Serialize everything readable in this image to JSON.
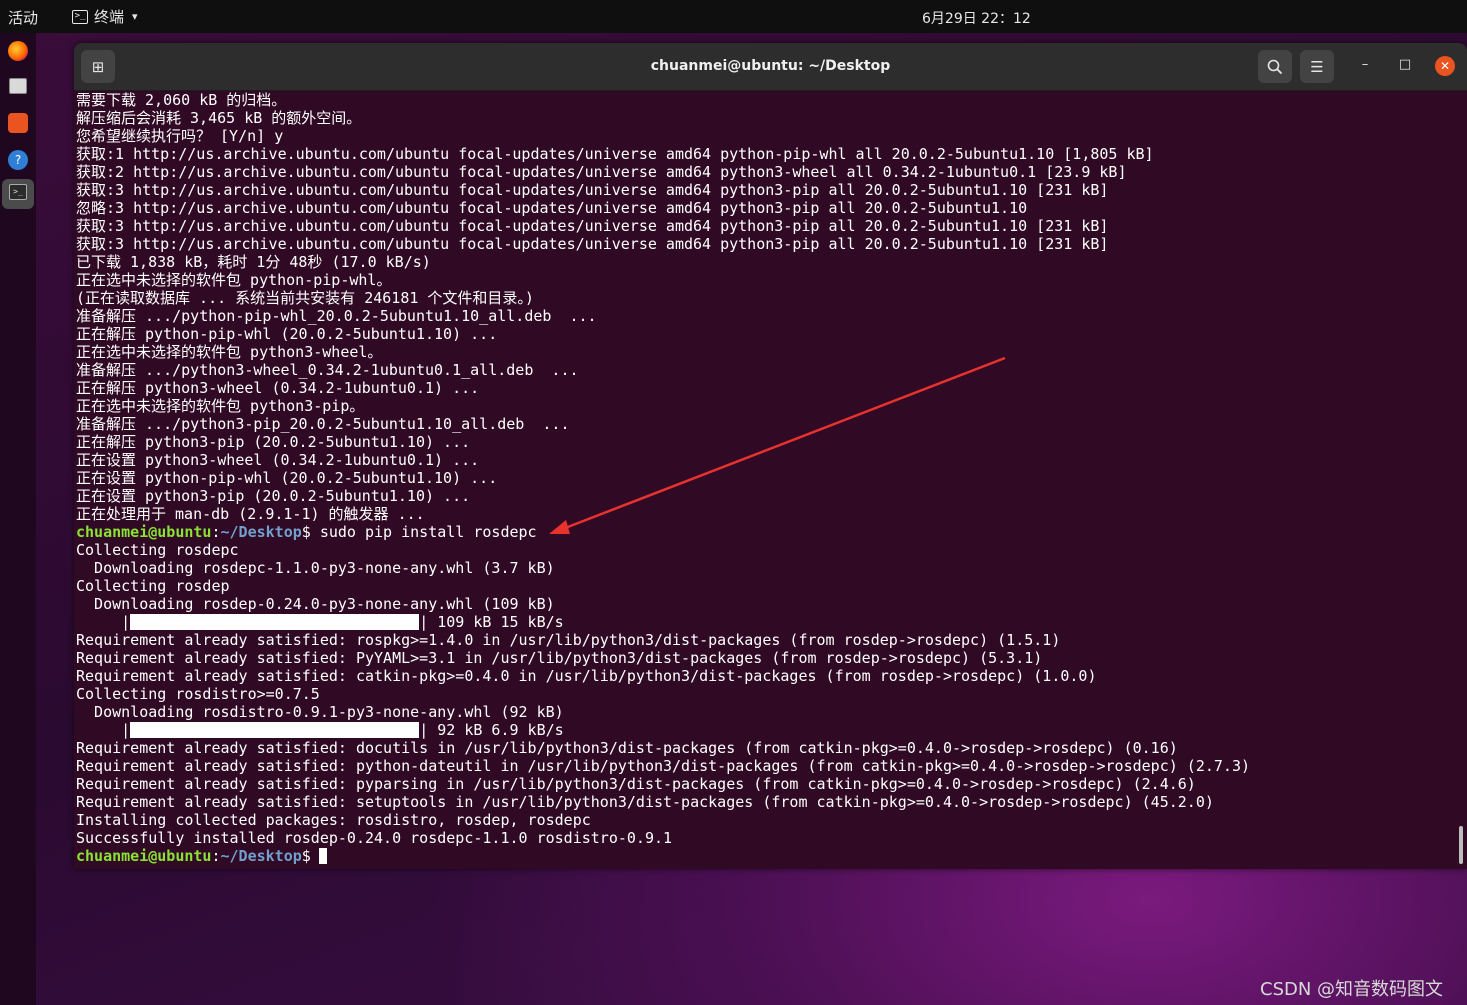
{
  "topbar": {
    "activities": "活动",
    "app_icon": "terminal-icon",
    "app_name": "终端",
    "caret": "▾",
    "clock": "6月29日  22：12"
  },
  "dock": {
    "apps": [
      "firefox-icon",
      "files-icon",
      "software-store-icon",
      "help-icon",
      "terminal-icon"
    ]
  },
  "window": {
    "title": "chuanmei@ubuntu: ~/Desktop",
    "new_tab_icon": "⊞",
    "search_icon": "⌕",
    "menu_icon": "☰",
    "minimize": "–",
    "maximize": "□",
    "close": "✕"
  },
  "prompt": {
    "user": "chuanmei@ubuntu",
    "colon": ":",
    "path": "~/Desktop",
    "dollar": "$"
  },
  "lines_before": [
    "需要下载 2,060 kB 的归档。",
    "解压缩后会消耗 3,465 kB 的额外空间。",
    "您希望继续执行吗？ [Y/n] y",
    "获取:1 http://us.archive.ubuntu.com/ubuntu focal-updates/universe amd64 python-pip-whl all 20.0.2-5ubuntu1.10 [1,805 kB]",
    "获取:2 http://us.archive.ubuntu.com/ubuntu focal-updates/universe amd64 python3-wheel all 0.34.2-1ubuntu0.1 [23.9 kB]",
    "获取:3 http://us.archive.ubuntu.com/ubuntu focal-updates/universe amd64 python3-pip all 20.0.2-5ubuntu1.10 [231 kB]",
    "忽略:3 http://us.archive.ubuntu.com/ubuntu focal-updates/universe amd64 python3-pip all 20.0.2-5ubuntu1.10",
    "获取:3 http://us.archive.ubuntu.com/ubuntu focal-updates/universe amd64 python3-pip all 20.0.2-5ubuntu1.10 [231 kB]",
    "获取:3 http://us.archive.ubuntu.com/ubuntu focal-updates/universe amd64 python3-pip all 20.0.2-5ubuntu1.10 [231 kB]",
    "已下载 1,838 kB，耗时 1分 48秒 (17.0 kB/s)",
    "正在选中未选择的软件包 python-pip-whl。",
    "(正在读取数据库 ... 系统当前共安装有 246181 个文件和目录。)",
    "准备解压 .../python-pip-whl_20.0.2-5ubuntu1.10_all.deb  ...",
    "正在解压 python-pip-whl (20.0.2-5ubuntu1.10) ...",
    "正在选中未选择的软件包 python3-wheel。",
    "准备解压 .../python3-wheel_0.34.2-1ubuntu0.1_all.deb  ...",
    "正在解压 python3-wheel (0.34.2-1ubuntu0.1) ...",
    "正在选中未选择的软件包 python3-pip。",
    "准备解压 .../python3-pip_20.0.2-5ubuntu1.10_all.deb  ...",
    "正在解压 python3-pip (20.0.2-5ubuntu1.10) ...",
    "正在设置 python3-wheel (0.34.2-1ubuntu0.1) ...",
    "正在设置 python-pip-whl (20.0.2-5ubuntu1.10) ...",
    "正在设置 python3-pip (20.0.2-5ubuntu1.10) ...",
    "正在处理用于 man-db (2.9.1-1) 的触发器 ..."
  ],
  "command": " sudo pip install rosdepc",
  "lines_mid1": [
    "Collecting rosdepc",
    "  Downloading rosdepc-1.1.0-py3-none-any.whl (3.7 kB)",
    "Collecting rosdep",
    "  Downloading rosdep-0.24.0-py3-none-any.whl (109 kB)"
  ],
  "progress1": {
    "prefix": "     |",
    "suffix": "| 109 kB 15 kB/s",
    "percent": 100
  },
  "lines_mid2": [
    "Requirement already satisfied: rospkg>=1.4.0 in /usr/lib/python3/dist-packages (from rosdep->rosdepc) (1.5.1)",
    "Requirement already satisfied: PyYAML>=3.1 in /usr/lib/python3/dist-packages (from rosdep->rosdepc) (5.3.1)",
    "Requirement already satisfied: catkin-pkg>=0.4.0 in /usr/lib/python3/dist-packages (from rosdep->rosdepc) (1.0.0)",
    "Collecting rosdistro>=0.7.5",
    "  Downloading rosdistro-0.9.1-py3-none-any.whl (92 kB)"
  ],
  "progress2": {
    "prefix": "     |",
    "suffix": "| 92 kB 6.9 kB/s",
    "percent": 100
  },
  "lines_after": [
    "Requirement already satisfied: docutils in /usr/lib/python3/dist-packages (from catkin-pkg>=0.4.0->rosdep->rosdepc) (0.16)",
    "Requirement already satisfied: python-dateutil in /usr/lib/python3/dist-packages (from catkin-pkg>=0.4.0->rosdep->rosdepc) (2.7.3)",
    "Requirement already satisfied: pyparsing in /usr/lib/python3/dist-packages (from catkin-pkg>=0.4.0->rosdep->rosdepc) (2.4.6)",
    "Requirement already satisfied: setuptools in /usr/lib/python3/dist-packages (from catkin-pkg>=0.4.0->rosdep->rosdepc) (45.2.0)",
    "Installing collected packages: rosdistro, rosdep, rosdepc",
    "Successfully installed rosdep-0.24.0 rosdepc-1.1.0 rosdistro-0.9.1"
  ],
  "annotation_color": "#e8322e",
  "watermark": "CSDN @知音数码图文"
}
